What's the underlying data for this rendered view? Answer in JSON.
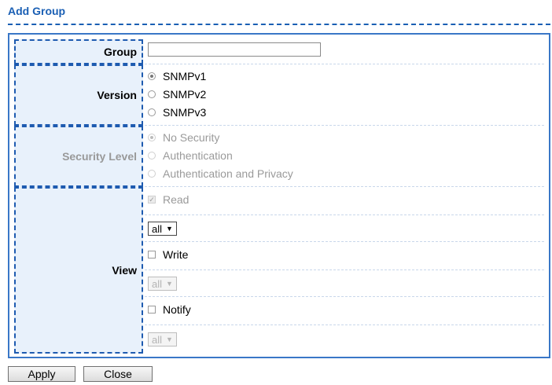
{
  "page": {
    "title": "Add Group"
  },
  "form": {
    "group": {
      "label": "Group",
      "value": ""
    },
    "version": {
      "label": "Version",
      "options": [
        {
          "label": "SNMPv1",
          "checked": true
        },
        {
          "label": "SNMPv2",
          "checked": false
        },
        {
          "label": "SNMPv3",
          "checked": false
        }
      ]
    },
    "security_level": {
      "label": "Security Level",
      "disabled": true,
      "options": [
        {
          "label": "No Security",
          "checked": true
        },
        {
          "label": "Authentication",
          "checked": false
        },
        {
          "label": "Authentication and Privacy",
          "checked": false
        }
      ]
    },
    "view": {
      "label": "View",
      "read": {
        "label": "Read",
        "checked": true,
        "disabled": true,
        "select_value": "all",
        "select_disabled": false
      },
      "write": {
        "label": "Write",
        "checked": false,
        "disabled": false,
        "select_value": "all",
        "select_disabled": true
      },
      "notify": {
        "label": "Notify",
        "checked": false,
        "disabled": false,
        "select_value": "all",
        "select_disabled": true
      }
    }
  },
  "buttons": {
    "apply": "Apply",
    "close": "Close"
  },
  "colors": {
    "accent": "#1a5fb4",
    "label_bg": "#e8f1fb",
    "disabled_text": "#999999"
  },
  "icons": {
    "select_arrow": "▼",
    "checkmark": "✓"
  }
}
